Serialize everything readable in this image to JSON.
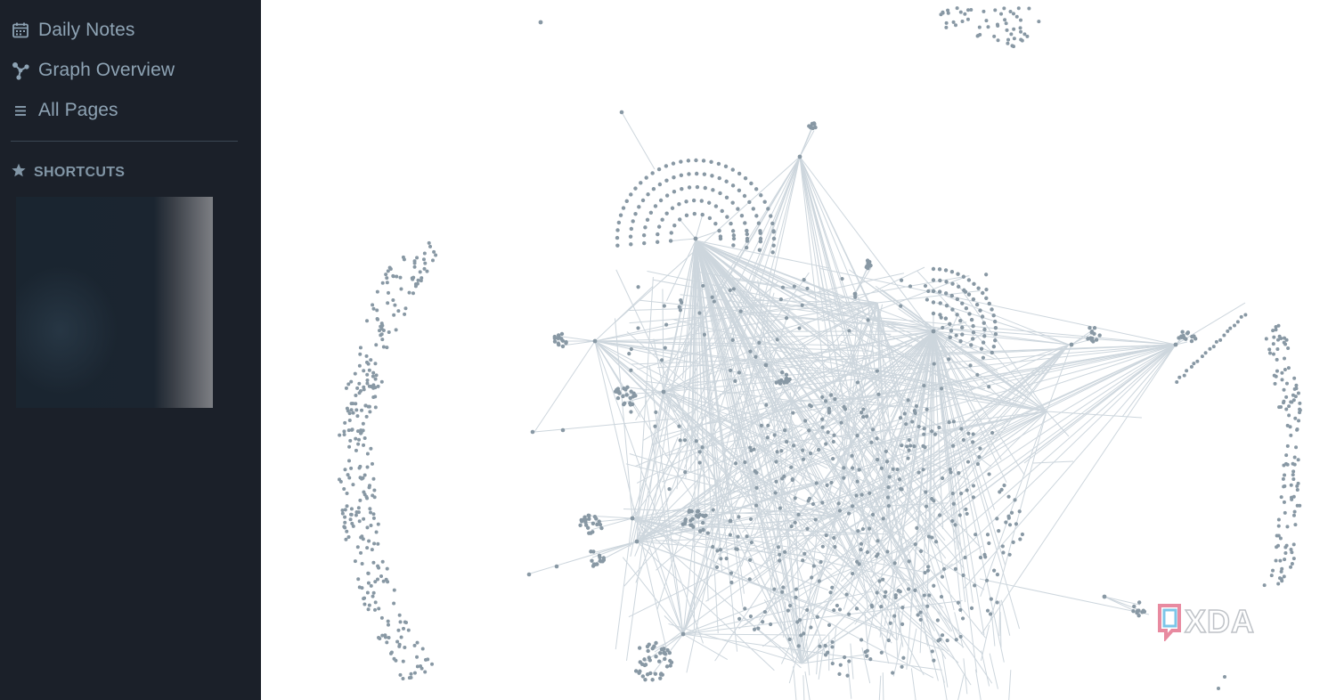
{
  "sidebar": {
    "items": [
      {
        "label": "Daily Notes",
        "icon": "calendar-icon"
      },
      {
        "label": "Graph Overview",
        "icon": "graph-icon"
      },
      {
        "label": "All Pages",
        "icon": "list-icon"
      }
    ],
    "shortcuts_heading": "SHORTCUTS",
    "shortcuts_icon": "star-icon"
  },
  "watermark": {
    "text": "XDA"
  },
  "colors": {
    "sidebar_bg": "#1b2029",
    "sidebar_text": "#8ea3b4",
    "graph_node": "#8898a4",
    "graph_edge": "#cdd6dd"
  }
}
